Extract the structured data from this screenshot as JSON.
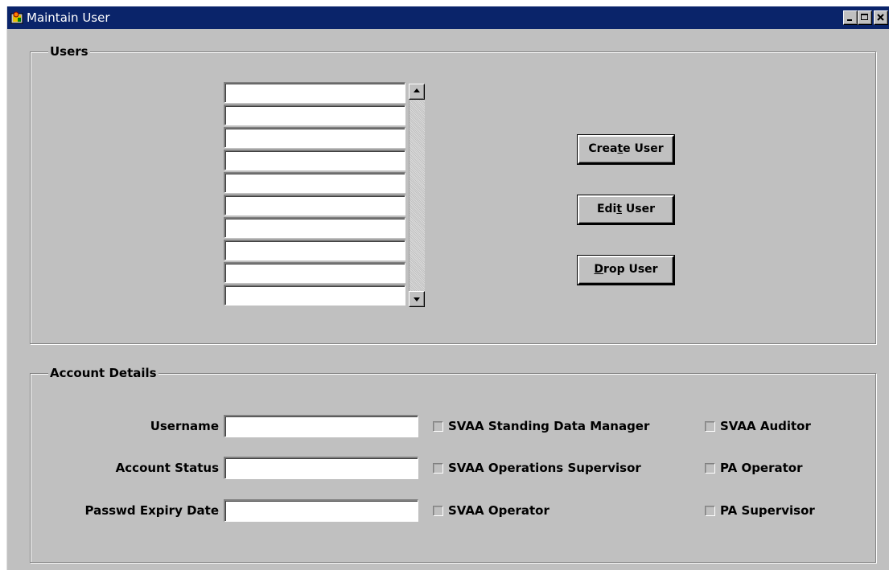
{
  "window": {
    "title": "Maintain User",
    "title_bar_color": "#0a246a",
    "background_color": "#c0c0c0"
  },
  "title_buttons": [
    "minimize-icon",
    "maximize-icon",
    "close-icon"
  ],
  "users_group": {
    "label": "Users",
    "list_rows": [
      "",
      "",
      "",
      "",
      "",
      "",
      "",
      "",
      "",
      ""
    ],
    "buttons": {
      "create_pre": "Crea",
      "create_mnemonic": "t",
      "create_post": "e User",
      "edit_pre": "Edi",
      "edit_mnemonic": "t",
      "edit_post": " User",
      "drop_pre": "",
      "drop_mnemonic": "D",
      "drop_post": "rop User"
    }
  },
  "account_group": {
    "label": "Account Details",
    "username_label": "Username",
    "username_value": "",
    "status_label": "Account Status",
    "status_value": "",
    "expiry_label": "Passwd Expiry Date",
    "expiry_value": "",
    "roles": [
      {
        "label": "SVAA Standing Data Manager",
        "checked": false
      },
      {
        "label": "SVAA Operations Supervisor",
        "checked": false
      },
      {
        "label": "SVAA Operator",
        "checked": false
      },
      {
        "label": "SVAA Auditor",
        "checked": false
      },
      {
        "label": "PA Operator",
        "checked": false
      },
      {
        "label": "PA Supervisor",
        "checked": false
      }
    ]
  }
}
